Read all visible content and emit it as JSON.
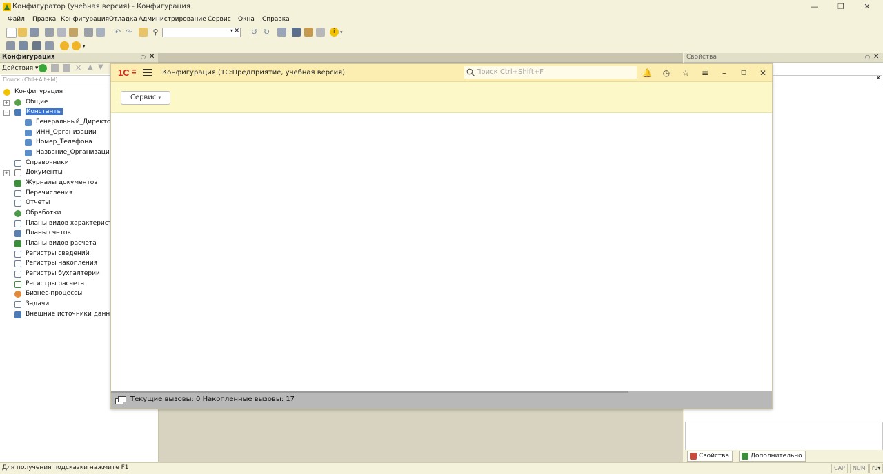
{
  "window": {
    "title": "Конфигуратор (учебная версия) - Конфигурация"
  },
  "menu": {
    "items": [
      "Файл",
      "Правка",
      "Конфигурация",
      "Отладка",
      "Администрирование",
      "Сервис",
      "Окна",
      "Справка"
    ]
  },
  "left_panel": {
    "title": "Конфигурация",
    "actions_label": "Действия",
    "search_placeholder": "Поиск (Ctrl+Alt+M)",
    "tree": [
      {
        "label": "Конфигурация",
        "icon": "configuration-icon",
        "level": 0
      },
      {
        "label": "Общие",
        "icon": "common-icon",
        "level": 1,
        "expandable": true
      },
      {
        "label": "Константы",
        "icon": "constants-icon",
        "level": 1,
        "expanded": true,
        "selected": true
      },
      {
        "label": "Генеральный_Директор",
        "icon": "constant-icon",
        "level": 2
      },
      {
        "label": "ИНН_Организации",
        "icon": "constant-icon",
        "level": 2
      },
      {
        "label": "Номер_Телефона",
        "icon": "constant-icon",
        "level": 2
      },
      {
        "label": "Название_Организации",
        "icon": "constant-icon",
        "level": 2
      },
      {
        "label": "Справочники",
        "icon": "catalogs-icon",
        "level": 1
      },
      {
        "label": "Документы",
        "icon": "documents-icon",
        "level": 1,
        "expandable": true
      },
      {
        "label": "Журналы документов",
        "icon": "document-journals-icon",
        "level": 1
      },
      {
        "label": "Перечисления",
        "icon": "enums-icon",
        "level": 1
      },
      {
        "label": "Отчеты",
        "icon": "reports-icon",
        "level": 1
      },
      {
        "label": "Обработки",
        "icon": "data-processors-icon",
        "level": 1
      },
      {
        "label": "Планы видов характеристик",
        "icon": "chart-of-characteristics-icon",
        "level": 1
      },
      {
        "label": "Планы счетов",
        "icon": "chart-of-accounts-icon",
        "level": 1
      },
      {
        "label": "Планы видов расчета",
        "icon": "chart-of-calculation-icon",
        "level": 1
      },
      {
        "label": "Регистры сведений",
        "icon": "information-registers-icon",
        "level": 1
      },
      {
        "label": "Регистры накопления",
        "icon": "accumulation-registers-icon",
        "level": 1
      },
      {
        "label": "Регистры бухгалтерии",
        "icon": "accounting-registers-icon",
        "level": 1
      },
      {
        "label": "Регистры расчета",
        "icon": "calculation-registers-icon",
        "level": 1
      },
      {
        "label": "Бизнес-процессы",
        "icon": "business-processes-icon",
        "level": 1
      },
      {
        "label": "Задачи",
        "icon": "tasks-icon",
        "level": 1
      },
      {
        "label": "Внешние источники данных",
        "icon": "external-data-sources-icon",
        "level": 1
      }
    ]
  },
  "right_panel": {
    "title": "Свойства",
    "tabs": [
      "Свойства",
      "Дополнительно"
    ]
  },
  "onec_window": {
    "title": "Конфигурация  (1С:Предприятие, учебная версия)",
    "search_placeholder": "Поиск Ctrl+Shift+F",
    "service_button": "Сервис",
    "status_text": "Текущие вызовы: 0   Накопленные вызовы: 17"
  },
  "statusbar": {
    "hint": "Для получения подсказки нажмите F1",
    "indicators": [
      "CAP",
      "NUM",
      "ru"
    ]
  },
  "colors": {
    "app_background": "#f5f2dc",
    "onec_header": "#fbeeb0",
    "onec_cmdbar": "#fdf8c7",
    "logo_red": "#d72a1f",
    "selection": "#3875d7"
  }
}
